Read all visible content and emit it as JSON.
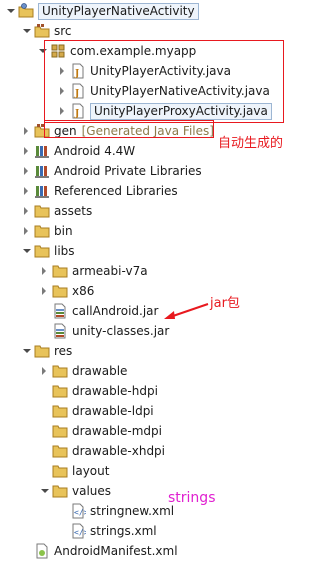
{
  "tree": [
    {
      "label": "UnityPlayerNativeActivity",
      "icon": "project-icon",
      "state": "expanded",
      "sel": true
    },
    {
      "label": "src",
      "icon": "source-folder-icon",
      "state": "expanded"
    },
    {
      "label": "com.example.myapp",
      "icon": "package-icon",
      "state": "expanded"
    },
    {
      "label": "UnityPlayerActivity.java",
      "icon": "java-file-icon",
      "state": "collapsed"
    },
    {
      "label": "UnityPlayerNativeActivity.java",
      "icon": "java-file-icon",
      "state": "collapsed"
    },
    {
      "label": "UnityPlayerProxyActivity.java",
      "icon": "java-file-icon",
      "state": "collapsed",
      "sel": true
    },
    {
      "label": "gen",
      "icon": "source-folder-icon",
      "state": "collapsed",
      "extra": "[Generated Java Files]"
    },
    {
      "label": "Android 4.4W",
      "icon": "library-icon",
      "state": "collapsed"
    },
    {
      "label": "Android Private Libraries",
      "icon": "library-icon",
      "state": "collapsed"
    },
    {
      "label": "Referenced Libraries",
      "icon": "library-icon",
      "state": "collapsed"
    },
    {
      "label": "assets",
      "icon": "folder-icon",
      "state": "collapsed"
    },
    {
      "label": "bin",
      "icon": "folder-icon",
      "state": "collapsed"
    },
    {
      "label": "libs",
      "icon": "folder-icon",
      "state": "expanded"
    },
    {
      "label": "armeabi-v7a",
      "icon": "folder-icon",
      "state": "collapsed"
    },
    {
      "label": "x86",
      "icon": "folder-icon",
      "state": "collapsed"
    },
    {
      "label": "callAndroid.jar",
      "icon": "jar-icon",
      "state": "none"
    },
    {
      "label": "unity-classes.jar",
      "icon": "jar-icon",
      "state": "none"
    },
    {
      "label": "res",
      "icon": "folder-icon",
      "state": "expanded"
    },
    {
      "label": "drawable",
      "icon": "folder-icon",
      "state": "collapsed"
    },
    {
      "label": "drawable-hdpi",
      "icon": "folder-icon",
      "state": "none"
    },
    {
      "label": "drawable-ldpi",
      "icon": "folder-icon",
      "state": "none"
    },
    {
      "label": "drawable-mdpi",
      "icon": "folder-icon",
      "state": "none"
    },
    {
      "label": "drawable-xhdpi",
      "icon": "folder-icon",
      "state": "none"
    },
    {
      "label": "layout",
      "icon": "folder-icon",
      "state": "none"
    },
    {
      "label": "values",
      "icon": "folder-icon",
      "state": "expanded"
    },
    {
      "label": "stringnew.xml",
      "icon": "xml-file-icon",
      "state": "none"
    },
    {
      "label": "strings.xml",
      "icon": "xml-file-icon",
      "state": "none"
    },
    {
      "label": "AndroidManifest.xml",
      "icon": "manifest-icon",
      "state": "none"
    }
  ],
  "annotations": {
    "generated": "自动生成的",
    "jar": "jar包",
    "strings": "strings"
  },
  "colors": {
    "annotation_red": "#e8191f",
    "annotation_magenta": "#e020d0",
    "folder": "#e8c35a",
    "selection_border": "#9db6d3"
  }
}
